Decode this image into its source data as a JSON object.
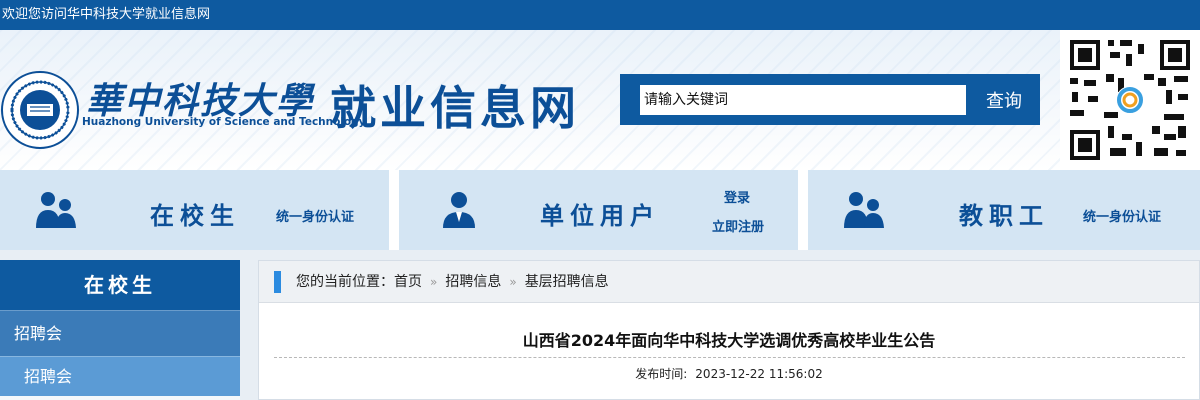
{
  "topbar": {
    "welcome": "欢迎您访问华中科技大学就业信息网"
  },
  "header": {
    "school_name_cn": "華中科技大學",
    "school_name_en": "Huazhong University of Science and Technology",
    "site_title": "就业信息网",
    "search": {
      "placeholder": "请输入关键词",
      "button_label": "查询"
    }
  },
  "entries": [
    {
      "label": "在校生",
      "links": [
        "统一身份认证"
      ]
    },
    {
      "label": "单位用户",
      "links": [
        "登录",
        "立即注册"
      ]
    },
    {
      "label": "教职工",
      "links": [
        "统一身份认证"
      ]
    }
  ],
  "sidebar": {
    "title": "在校生",
    "items": [
      {
        "label": "招聘会"
      },
      {
        "label": "招聘会"
      }
    ]
  },
  "breadcrumb": {
    "prefix": "您的当前位置：",
    "items": [
      "首页",
      "招聘信息",
      "基层招聘信息"
    ],
    "separator": "»"
  },
  "article": {
    "title": "山西省2024年面向华中科技大学选调优秀高校毕业生公告",
    "publish_label": "发布时间:",
    "publish_time": "2023-12-22 11:56:02"
  },
  "colors": {
    "brand": "#0e5aa0",
    "title_blue": "#0c4f97",
    "entry_bg": "#d4e5f3",
    "sidebar_item": "#3b7bb8",
    "sidebar_subitem": "#5b9bd5",
    "crumb_bar": "#2b8be0"
  },
  "icons": {
    "seal": "university-seal-icon",
    "student": "users-icon",
    "employer": "user-tie-icon",
    "staff": "users-icon",
    "qr": "qr-code-icon"
  }
}
